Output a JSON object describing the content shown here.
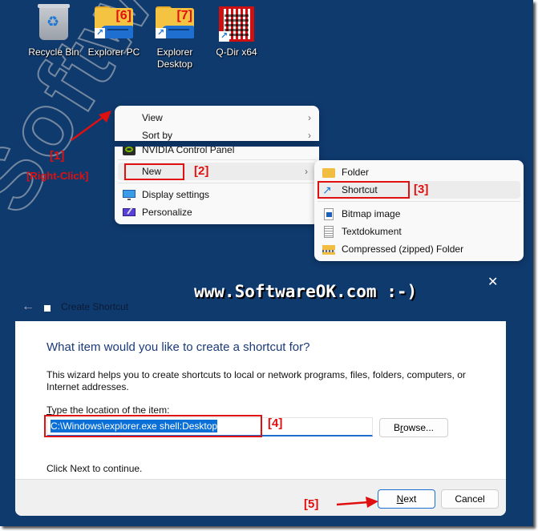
{
  "desktop": {
    "icons": [
      {
        "label": "Recycle Bin",
        "icon": "recycle-bin-icon"
      },
      {
        "label": "Explorer PC",
        "icon": "folder-shortcut-icon",
        "badge": "[6]"
      },
      {
        "label_line1": "Explorer",
        "label_line2": "Desktop",
        "icon": "folder-shortcut-icon",
        "badge": "[7]"
      },
      {
        "label": "Q-Dir x64",
        "icon": "qdir-icon"
      }
    ]
  },
  "annotations": {
    "step1": "[1]",
    "step1_sub": "[Right-Click]",
    "step2": "[2]",
    "step3": "[3]",
    "step4": "[4]",
    "step5": "[5]",
    "banner": "www.SoftwareOK.com :-)",
    "watermark": "SoftwareOK.com"
  },
  "context_menu": {
    "items": [
      {
        "label": "View",
        "has_submenu": true
      },
      {
        "label": "Sort by",
        "has_submenu": true
      },
      {
        "label": "NVIDIA Control Panel",
        "icon": "nvidia-icon"
      },
      {
        "label": "New",
        "has_submenu": true
      },
      {
        "label": "Display settings",
        "icon": "display-icon"
      },
      {
        "label": "Personalize",
        "icon": "personalize-icon"
      }
    ],
    "chevron": "›"
  },
  "new_submenu": {
    "items": [
      {
        "label": "Folder",
        "icon": "folder-icon"
      },
      {
        "label": "Shortcut",
        "icon": "shortcut-arrow-icon"
      },
      {
        "label": "Bitmap image",
        "icon": "bitmap-icon"
      },
      {
        "label": "Textdokument",
        "icon": "text-document-icon"
      },
      {
        "label": "Compressed (zipped) Folder",
        "icon": "zip-folder-icon"
      }
    ]
  },
  "dialog": {
    "back": "←",
    "title": "Create Shortcut",
    "close": "✕",
    "heading": "What item would you like to create a shortcut for?",
    "description": "This wizard helps you to create shortcuts to local or network programs, files, folders, computers, or Internet addresses.",
    "location_label_mnemonic": "T",
    "location_label_rest": "ype the location of the item:",
    "location_value": "C:\\Windows\\explorer.exe shell:Desktop",
    "browse_pre": "B",
    "browse_mnemonic": "r",
    "browse_post": "owse...",
    "hint": "Click Next to continue.",
    "next_mnemonic": "N",
    "next_rest": "ext",
    "cancel": "Cancel"
  },
  "colors": {
    "desktop_bg": "#0f3a6e",
    "annotation_red": "#e01010",
    "accent_blue": "#1a6fd0",
    "heading_blue": "#1a3a7a"
  }
}
